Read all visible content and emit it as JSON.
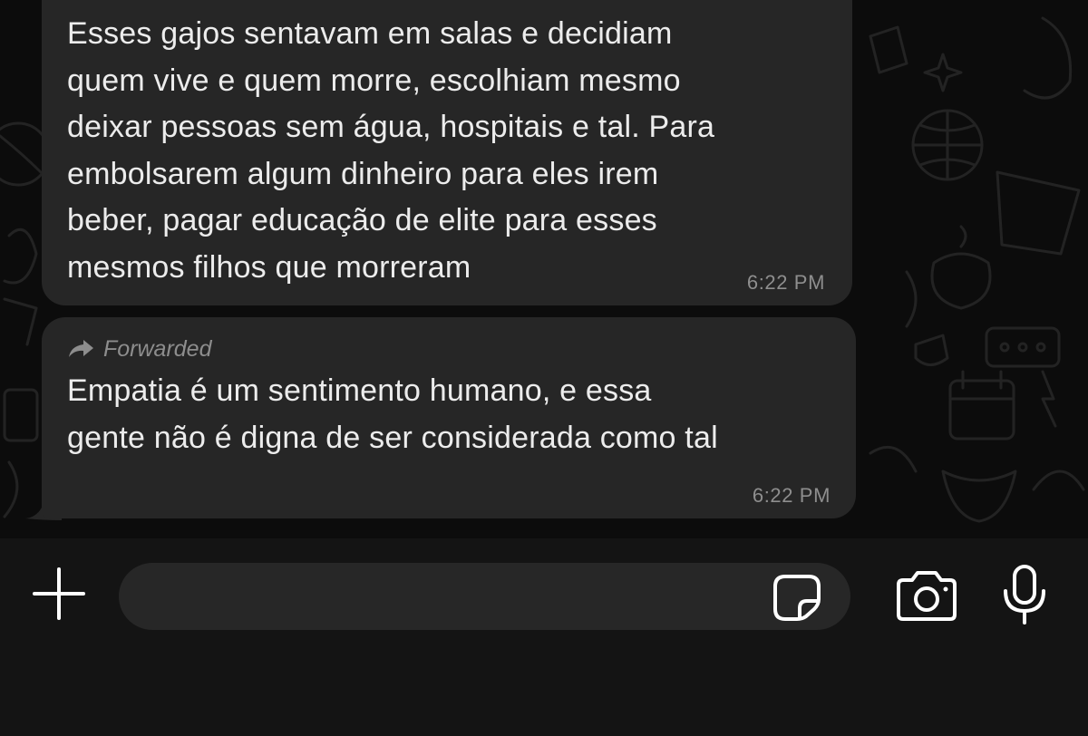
{
  "chat": {
    "messages": [
      {
        "text": "Esses gajos sentavam em salas e decidiam\nquem vive e quem morre, escolhiam mesmo\ndeixar pessoas sem água, hospitais e tal. Para\nembolsarem algum dinheiro para eles irem\nbeber, pagar educação de elite para esses\nmesmos filhos que morreram",
        "time": "6:22 PM"
      },
      {
        "forwarded_label": "Forwarded",
        "text": "Empatia é um sentimento humano, e essa\ngente não é digna de ser considerada como tal",
        "time": "6:22 PM"
      }
    ]
  },
  "composer": {
    "input_value": "",
    "icons": [
      "plus-icon",
      "sticker-icon",
      "camera-icon",
      "microphone-icon"
    ]
  },
  "colors": {
    "background": "#0c0c0c",
    "bubble": "#262626",
    "text": "#ececec",
    "timestamp": "#8e8e8e",
    "composer_bar": "#141414",
    "input": "#272727",
    "icon": "#ffffff"
  }
}
